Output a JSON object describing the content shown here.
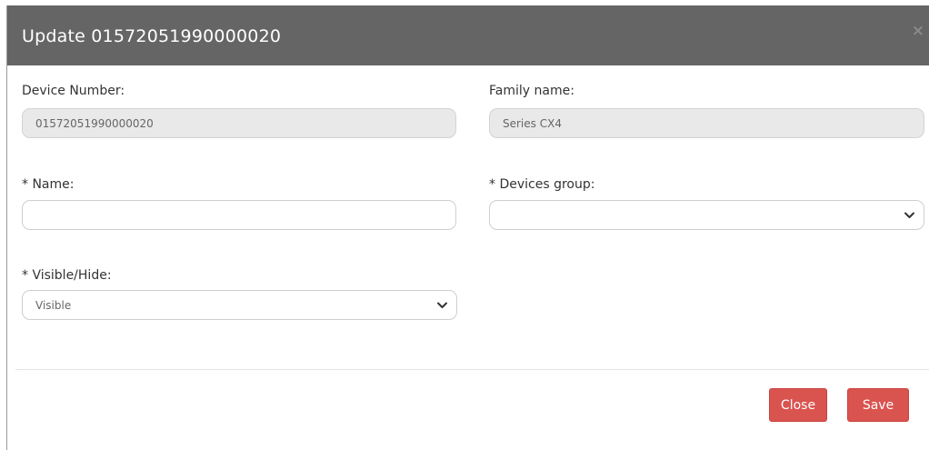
{
  "modal": {
    "title": "Update 01572051990000020",
    "close_icon_glyph": "×"
  },
  "fields": {
    "device_number": {
      "label": "Device Number:",
      "value": "01572051990000020"
    },
    "family_name": {
      "label": "Family name:",
      "value": "Series CX4"
    },
    "name": {
      "label": "* Name:",
      "value": ""
    },
    "devices_group": {
      "label": "* Devices group:",
      "selected": ""
    },
    "visible_hide": {
      "label": "* Visible/Hide:",
      "selected": "Visible"
    }
  },
  "footer": {
    "close_label": "Close",
    "save_label": "Save"
  },
  "colors": {
    "header_bg": "#656565",
    "button_bg": "#d9534f"
  },
  "icons": [
    "close-icon",
    "chevron-down-icon"
  ]
}
